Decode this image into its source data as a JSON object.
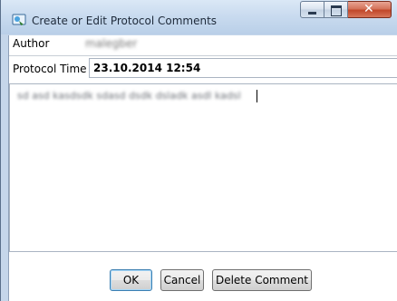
{
  "window": {
    "title": "Create or Edit Protocol Comments",
    "caption_buttons": {
      "minimize": "minimize",
      "maximize": "maximize",
      "close": "close"
    }
  },
  "form": {
    "author_label": "Author",
    "author_value": "malegber",
    "protocol_time_label": "Protocol Time",
    "protocol_time_value": "23.10.2014 12:54",
    "comment_text": "sd asd kasdsdk sdasd dsdk dsladk asdl kadsl"
  },
  "buttons": {
    "ok": "OK",
    "cancel": "Cancel",
    "delete": "Delete Comment"
  },
  "colors": {
    "titlebar": "#c9dbef",
    "close_button": "#c1472a",
    "default_button_border": "#3c7fb1"
  },
  "icons": {
    "app_icon": "protocol-comments-icon",
    "minimize": "minimize-icon",
    "maximize": "maximize-icon",
    "close": "close-icon"
  }
}
